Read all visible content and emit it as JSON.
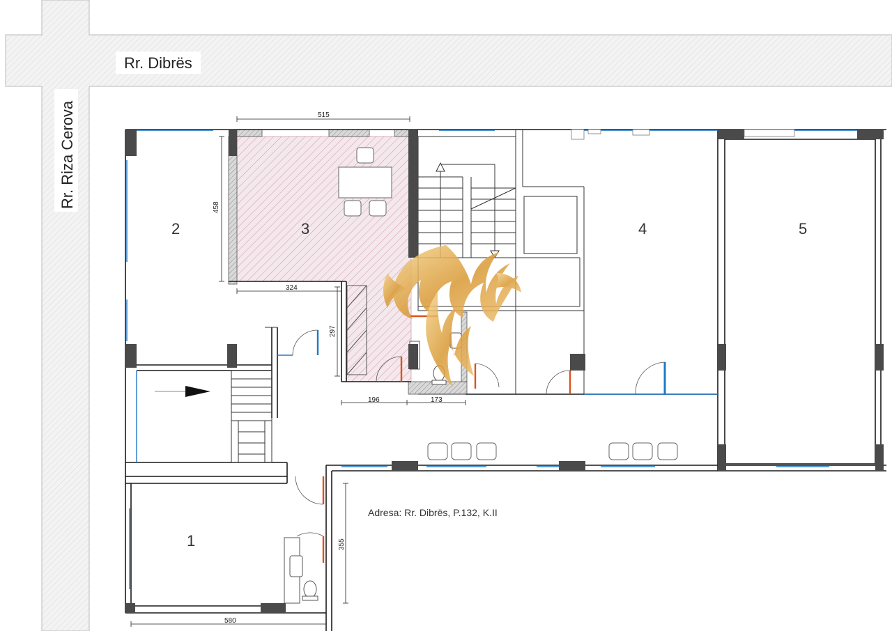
{
  "streets": {
    "horizontal": "Rr. Dibrës",
    "vertical": "Rr. Riza Cerova"
  },
  "rooms": [
    "2",
    "3",
    "4",
    "5",
    "1"
  ],
  "dimensions": {
    "room3_width": "515",
    "room3_height": "458",
    "room3_bottom": "324",
    "corridor_height": "297",
    "bottom_left": "196",
    "bottom_right": "173",
    "room1_height": "355",
    "room1_width": "580"
  },
  "address": "Adresa: Rr. Dibrës, P.132, K.II",
  "colors": {
    "wall": "#1a1a1a",
    "column": "#4a4a4a",
    "window": "#1e78c8",
    "door": "#d9531e",
    "hatch": "#b96c7e",
    "street": "#efefef",
    "logo": "#e0a94a"
  },
  "icons": {
    "logo": "phoenix-logo-watermark",
    "entrance": "entrance-arrow-icon"
  }
}
